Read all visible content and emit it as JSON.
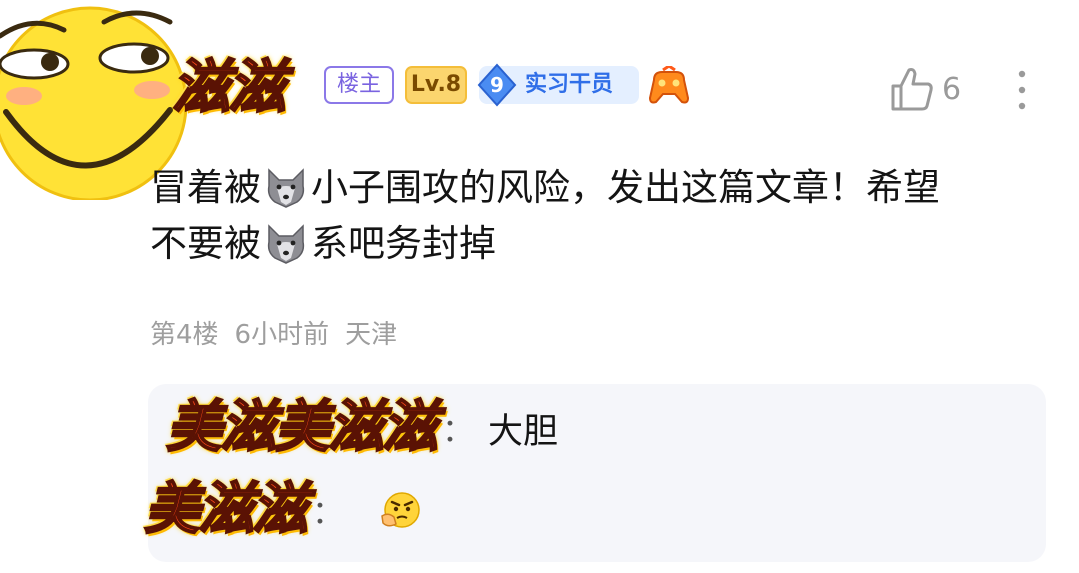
{
  "post": {
    "avatar_icon": "smug-face-thumbs-up-icon",
    "username": "滋滋",
    "badges": {
      "owner": "楼主",
      "level": "Lv.8",
      "rank_number": "9",
      "rank_title": "实习干员"
    },
    "medal_icon": "game-controller-medal-icon",
    "like_count": "6",
    "content": {
      "line1_a": "冒着被",
      "line1_b": "小子围攻的风险，发出这篇文章！希望",
      "line2_a": "不要被",
      "line2_b": "系吧务封掉",
      "inline_icon": "wolf-icon"
    },
    "meta": {
      "floor": "第4楼",
      "time": "6小时前",
      "location": "天津"
    }
  },
  "replies": [
    {
      "username": "美滋美滋滋",
      "separator": "：",
      "text": "大胆"
    },
    {
      "username": "美滋滋",
      "separator": "：",
      "text": "",
      "emoji_icon": "thinking-angry-face-icon"
    }
  ],
  "colors": {
    "owner_badge": "#7a63e0",
    "level_badge": "#fbd56e",
    "rank_badge": "#2f6ee8",
    "reply_bg": "#f5f6fa",
    "meta_text": "#9e9e9e"
  }
}
